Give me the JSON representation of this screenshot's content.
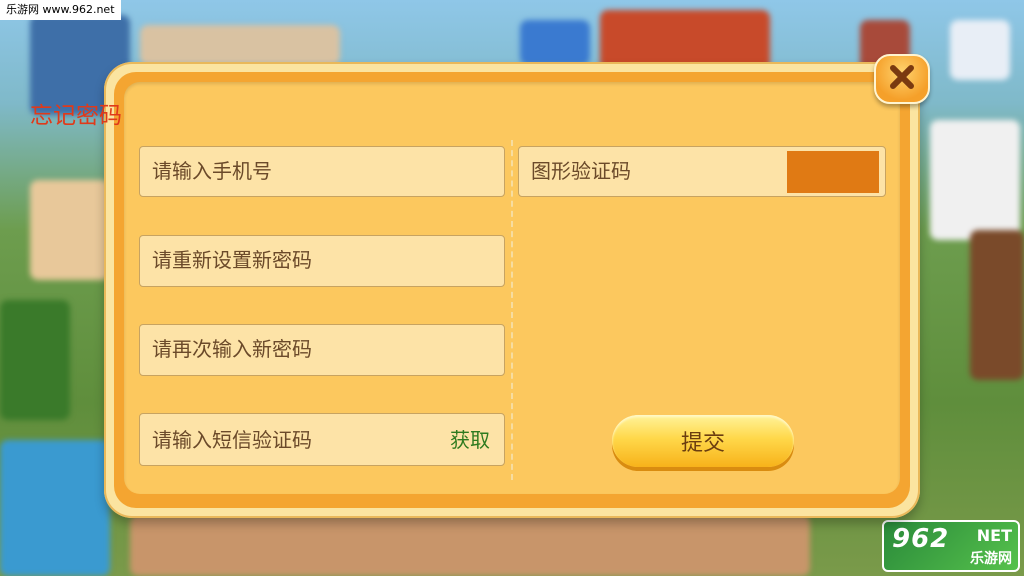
{
  "watermark": "乐游网 www.962.net",
  "logo": {
    "big": "962",
    "net": "NET",
    "small": "乐游网"
  },
  "dialog": {
    "title": "忘记密码",
    "phone_placeholder": "请输入手机号",
    "new_password_placeholder": "请重新设置新密码",
    "confirm_password_placeholder": "请再次输入新密码",
    "sms_code_placeholder": "请输入短信验证码",
    "sms_get_label": "获取",
    "captcha_placeholder": "图形验证码",
    "submit_label": "提交",
    "close_label": "✕"
  },
  "colors": {
    "title": "#e03a1a",
    "panel": "#fcc85e",
    "get_link": "#2e7a1f",
    "captcha": "#e07a14"
  }
}
